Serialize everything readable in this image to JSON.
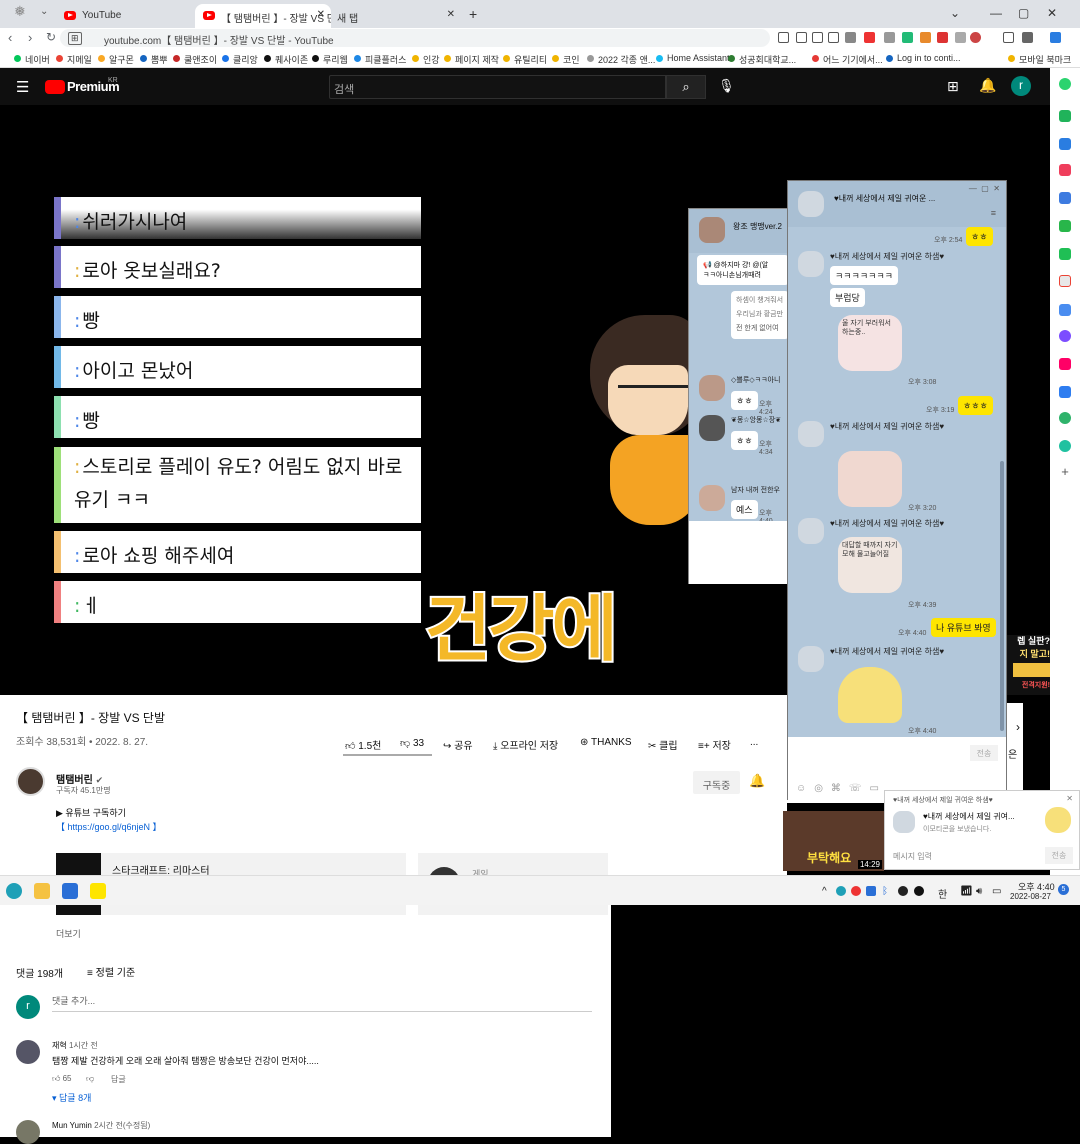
{
  "browser": {
    "tabs": [
      {
        "label": "YouTube"
      },
      {
        "label": "【 탬탬버린 】- 장발 VS 단발 - YouTube"
      },
      {
        "label": "새 탭"
      }
    ],
    "url": "youtube.com【 탬탬버린 】- 장발 VS 단발 - YouTube",
    "bookmarks": [
      "네이버",
      "지메일",
      "알구몬",
      "뽐뿌",
      "쿨앤조이",
      "클리앙",
      "퀘사이존",
      "루리웹",
      "피클플러스",
      "인강",
      "페이지 제작",
      "유틸리티",
      "코인",
      "2022 각종 앤...",
      "Home Assistant",
      "성공회대학교...",
      "어느 기기에서...",
      "Log in to conti...",
      "모바일 북마크"
    ]
  },
  "youtube": {
    "logo": "Premium",
    "logo_region": "KR",
    "search_placeholder": "검색",
    "avatar_letter": "r",
    "video": {
      "chat_lines": [
        "쉬러가시나여",
        "로아 옷보실래요?",
        "빵",
        "아이고 몬났어",
        "빵",
        "스토리로 플레이 유도? 어림도 없지 바로",
        "유기 ㅋㅋ",
        "로아 쇼핑 해주세여",
        "ㅔ"
      ],
      "caption": "건강에",
      "side_ad": [
        "렙 실판?",
        "지 말고!",
        "전격지원!"
      ]
    },
    "title": "【 탬탬버린 】- 장발 VS 단발",
    "meta": "조회수 38,531회 • 2022. 8. 27.",
    "actions": {
      "like": "1.5천",
      "dislike": "33",
      "share": "공유",
      "offline": "오프라인 저장",
      "thanks": "THANKS",
      "clip": "클립",
      "save": "저장",
      "more": "..."
    },
    "channel": {
      "name": "탬탬버린",
      "subs": "구독자 45.1만명",
      "subscribe": "구독중"
    },
    "desc": {
      "line1": "▶ 유튜브 구독하기",
      "line2": "【 https://goo.gl/q6njeN 】",
      "game": "스타크래프트: 리마스터",
      "game2": "게임",
      "more": "더보기"
    },
    "comments": {
      "count": "댓글 198개",
      "sort": "정렬 기준",
      "add": "댓글 추가...",
      "c1": {
        "author": "재혁",
        "time": "1시간 전",
        "text": "탬짱 제발 건강하게 오래 오래 살아줘 탬짱은 방송보단 건강이 먼저야.....",
        "likes": "65",
        "reply": "답글",
        "replies": "답글 8개"
      },
      "c2": {
        "author": "Mun Yumin",
        "time": "2시간 전(수정됨)"
      }
    },
    "rec": {
      "duration": "14:29",
      "thumb_text": "부탁해요",
      "suffix": "은"
    }
  },
  "katalk": {
    "win1": {
      "title": "왕조 맹맹ver.2",
      "notice": "@하지마 걍! @(알",
      "notice2": "ㅋㅋ아니손님개때려",
      "msg_a": "하셈이 챙겨줘서",
      "msg_b": "우리님과 황금만",
      "msg_c": "전 한게 없어여",
      "n1": "◇뽈루◇ㅋㅋ아니",
      "b1": "ㅎㅎ",
      "t1": "오후 4:24",
      "n2": "❦몽☆앙몽☆장❦",
      "b2": "ㅎㅎ",
      "t2": "오후 4:34",
      "n3": "남자 내꺼 전한우",
      "b3": "예스",
      "t3": "오후 4:40"
    },
    "win2": {
      "title": "♥내꺼 세상에서 제일 귀여운 ...",
      "sender": "♥내꺼 세상에서 제일 귀여운 하샘♥",
      "t0": "오후 2:54",
      "y0": "ㅎㅎ",
      "w1": "ㅋㅋㅋㅋㅋㅋㅋ",
      "w2": "부럽당",
      "st1": "울 자기 부러워서 하는중..",
      "t1": "오후 3:08",
      "y1": "ㅎㅎㅎ",
      "t1b": "오후 3:19",
      "t2": "오후 3:20",
      "st2": "대답할 때까지 자기 모해 물고늘어질",
      "t3": "오후 4:39",
      "y2": "나 유튜브 봐영",
      "t3b": "오후 4:40",
      "t4": "오후 4:40",
      "send": "전송"
    },
    "notif": {
      "title": "♥내꺼 세상에서 제일 귀여운 하샘♥",
      "sub": "♥내꺼 세상에서 제일 귀여...",
      "text": "이모티콘을 보냈습니다.",
      "input": "메시지 입력",
      "send": "전송"
    }
  },
  "taskbar": {
    "ime": "한",
    "time": "오후 4:40",
    "date": "2022-08-27",
    "badge": "5"
  }
}
